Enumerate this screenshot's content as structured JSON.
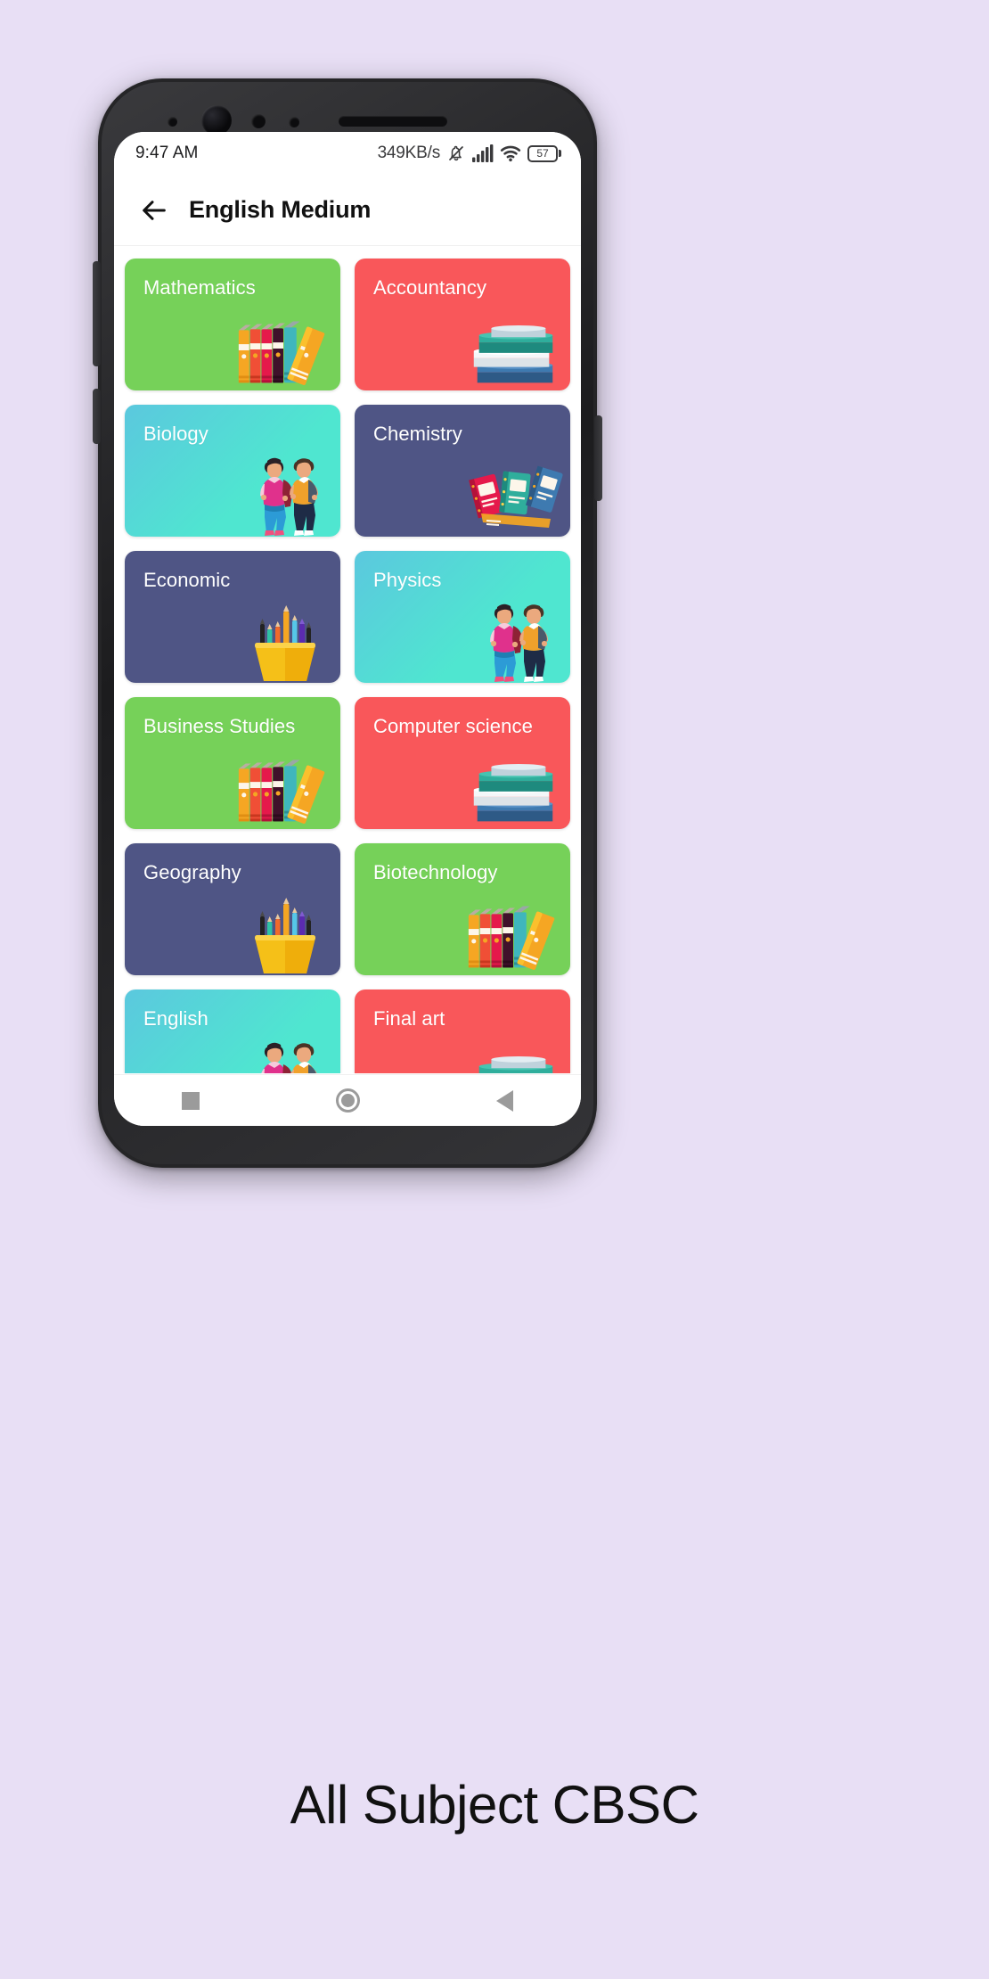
{
  "page": {
    "background_color": "#e8dff5",
    "caption": "All Subject CBSC"
  },
  "status_bar": {
    "time": "9:47 AM",
    "network_speed": "349KB/s",
    "icons": [
      "bell-muted-icon",
      "signal-bars-icon",
      "wifi-icon"
    ],
    "battery_percent": "57"
  },
  "app_bar": {
    "back_icon": "back-arrow-icon",
    "title": "English Medium"
  },
  "subjects": [
    {
      "label": "Mathematics",
      "color": "#76D159",
      "gradient": false,
      "art": "standing-books"
    },
    {
      "label": "Accountancy",
      "color": "#F9575A",
      "gradient": false,
      "art": "stacked-books"
    },
    {
      "label": "Biology",
      "color": "#5BC8DE",
      "color2": "#4FE6D0",
      "gradient": true,
      "art": "two-students"
    },
    {
      "label": "Chemistry",
      "color": "#4F5585",
      "gradient": false,
      "art": "notebooks"
    },
    {
      "label": "Economic",
      "color": "#4F5585",
      "gradient": false,
      "art": "pencil-cup"
    },
    {
      "label": "Physics",
      "color": "#5BC8DE",
      "color2": "#4FE6D0",
      "gradient": true,
      "art": "two-students"
    },
    {
      "label": "Business Studies",
      "color": "#76D159",
      "gradient": false,
      "art": "standing-books"
    },
    {
      "label": "Computer science",
      "color": "#F9575A",
      "gradient": false,
      "art": "stacked-books"
    },
    {
      "label": "Geography",
      "color": "#4F5585",
      "gradient": false,
      "art": "pencil-cup"
    },
    {
      "label": "Biotechnology",
      "color": "#76D159",
      "gradient": false,
      "art": "standing-books"
    },
    {
      "label": "English",
      "color": "#5BC8DE",
      "color2": "#4FE6D0",
      "gradient": true,
      "art": "two-students"
    },
    {
      "label": "Final art",
      "color": "#F9575A",
      "gradient": false,
      "art": "stacked-books"
    }
  ],
  "nav_bar": {
    "recents_icon": "square-icon",
    "home_icon": "circle-icon",
    "back_icon": "triangle-back-icon"
  }
}
